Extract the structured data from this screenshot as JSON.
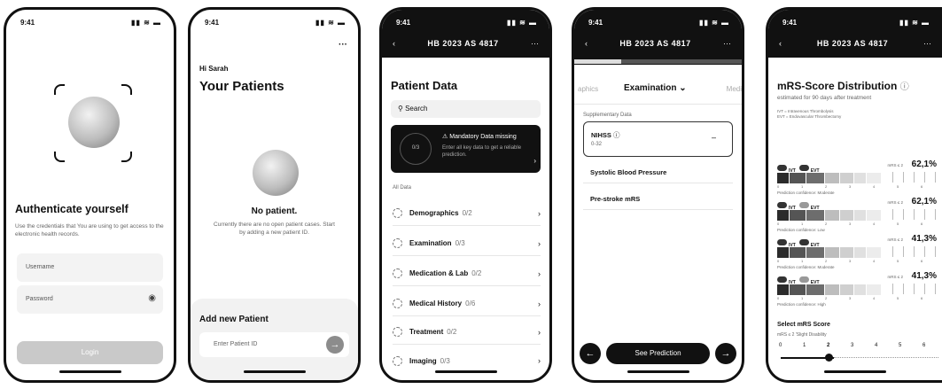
{
  "status_time": "9:41",
  "status_icons": "▮▮ ≋ ▬",
  "screen1": {
    "title": "Authenticate yourself",
    "subtitle": "Use the credentials that You are using to get access to the electronic health records.",
    "username_placeholder": "Username",
    "password_placeholder": "Password",
    "login_label": "Login"
  },
  "screen2": {
    "more": "···",
    "greeting": "Hi Sarah",
    "title": "Your Patients",
    "empty_title": "No patient.",
    "empty_text": "Currently there are no open patient cases. Start by adding a new patient ID.",
    "add_title": "Add new Patient",
    "input_placeholder": "Enter Patient ID"
  },
  "screen3": {
    "nav_title": "HB 2023 AS 4817",
    "title": "Patient Data",
    "search_placeholder": "Search",
    "alert_count": "0/3",
    "alert_title": "Mandatory Data missing",
    "alert_text": "Enter all key data to get a reliable prediction.",
    "section_label": "All Data",
    "items": [
      {
        "label": "Demographics",
        "count": "0/2"
      },
      {
        "label": "Examination",
        "count": "0/3"
      },
      {
        "label": "Medication & Lab",
        "count": "0/2"
      },
      {
        "label": "Medical History",
        "count": "0/6"
      },
      {
        "label": "Treatment",
        "count": "0/2"
      },
      {
        "label": "Imaging",
        "count": "0/3"
      }
    ]
  },
  "screen4": {
    "nav_title": "HB 2023 AS 4817",
    "tab_prev": "aphics",
    "tab_active": "Examination",
    "tab_next": "Medic",
    "supp_label": "Supplementary Data",
    "nihss_label": "NIHSS",
    "nihss_range": "0-32",
    "nihss_value": "–",
    "row1": "Systolic Blood Pressure",
    "row2": "Pre-stroke mRS",
    "see_prediction": "See Prediction"
  },
  "screen5": {
    "nav_title": "HB 2023 AS 4817",
    "title": "mRS-Score Distribution",
    "subtitle": "estimated for 90 days after treatment",
    "legend1": "IVT = Intravenous Thrombolysis",
    "legend2": "EVT = Endovascular Thrombectomy",
    "ivt": "IVT",
    "evt": "EVT",
    "mrs_label": "mRS ≤ 2",
    "rows": [
      {
        "value": "62,1%",
        "confidence": "Prediction confidence: Moderate",
        "fill": 0.621
      },
      {
        "value": "62,1%",
        "confidence": "Prediction confidence: Low",
        "fill": 0.621
      },
      {
        "value": "41,3%",
        "confidence": "Prediction confidence: Moderate",
        "fill": 0.413
      },
      {
        "value": "41,3%",
        "confidence": "Prediction confidence: High",
        "fill": 0.413
      }
    ],
    "select_title": "Select mRS Score",
    "select_sub": "mRS ≤ 2 'Slight Disability",
    "scale": [
      "0",
      "1",
      "2",
      "3",
      "4",
      "5",
      "6"
    ],
    "selected": "2"
  }
}
